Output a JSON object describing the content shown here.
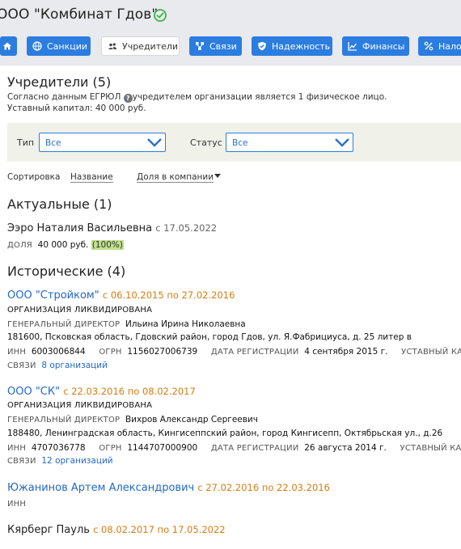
{
  "header": {
    "company_title": "ООО \"Комбинат Гдов\"",
    "status_icon": "check-circle-icon",
    "tabs": [
      {
        "label": "",
        "icon": "home-icon"
      },
      {
        "label": "Санкции",
        "icon": "globe-icon"
      },
      {
        "label": "Учредители",
        "icon": "people-icon",
        "active": true
      },
      {
        "label": "Связи",
        "icon": "network-icon"
      },
      {
        "label": "Надежность",
        "icon": "shield-check-icon"
      },
      {
        "label": "Финансы",
        "icon": "chart-icon"
      },
      {
        "label": "Налоги",
        "icon": "percent-icon"
      }
    ]
  },
  "founders": {
    "title": "Учредители (5)",
    "egrul_prefix": "Согласно данным ЕГРЮЛ",
    "egrul_suffix": "учредителем организации является 1 физическое лицо.",
    "capital": "Уставный капитал: 40 000 руб."
  },
  "filters": {
    "type_label": "Тип",
    "type_value": "Все",
    "status_label": "Статус",
    "status_value": "Все"
  },
  "sort": {
    "label": "Сортировка",
    "by_name": "Название",
    "by_share": "Доля в компании"
  },
  "current": {
    "title": "Актуальные (1)",
    "items": [
      {
        "name": "Ээро Наталия Васильевна",
        "date": "с 17.05.2022",
        "share_label": "ДОЛЯ",
        "share_value": "40 000 руб.",
        "share_pct": "(100%)"
      }
    ]
  },
  "historical": {
    "title": "Исторические (4)",
    "items": [
      {
        "name": "ООО \"Стройком\"",
        "dates": "с 06.10.2015 по 27.02.2016",
        "status": "ОРГАНИЗАЦИЯ ЛИКВИДИРОВАНА",
        "director_label": "ГЕНЕРАЛЬНЫЙ ДИРЕКТОР",
        "director": "Ильина Ирина Николаевна",
        "address": "181600, Псковская область, Гдовский район, город Гдов, ул. Я.Фабрициуса, д. 25 литер в",
        "inn_label": "ИНН",
        "inn": "6003006844",
        "ogrn_label": "ОГРН",
        "ogrn": "1156027006739",
        "reg_label": "ДАТА РЕГИСТРАЦИИ",
        "reg": "4 сентября 2015 г.",
        "capital_label": "УСТАВНЫЙ КАПИ",
        "links_label": "СВЯЗИ",
        "links": "8 организаций"
      },
      {
        "name": "ООО \"СК\"",
        "dates": "с 22.03.2016 по 08.02.2017",
        "status": "ОРГАНИЗАЦИЯ ЛИКВИДИРОВАНА",
        "director_label": "ГЕНЕРАЛЬНЫЙ ДИРЕКТОР",
        "director": "Вихров Александр Сергеевич",
        "address": "188480, Ленинградская область, Кингисеппский район, город Кингисепп, Октябрьская ул., д.26",
        "inn_label": "ИНН",
        "inn": "4707036778",
        "ogrn_label": "ОГРН",
        "ogrn": "1144707000900",
        "reg_label": "ДАТА РЕГИСТРАЦИИ",
        "reg": "26 августа 2014 г.",
        "capital_label": "УСТАВНЫЙ КАПИ",
        "links_label": "СВЯЗИ",
        "links": "12 организаций"
      },
      {
        "name": "Южанинов Артем Александрович",
        "dates": "с 27.02.2016 по 22.03.2016",
        "inn_label": "ИНН"
      },
      {
        "name": "Кярберг Пауль",
        "dates": "с 08.02.2017 по 17.05.2022"
      }
    ]
  },
  "colors": {
    "accent": "#2b7de0",
    "link": "#2369c5",
    "date": "#d47c10",
    "liquidated": "#e33b2f",
    "share_highlight": "#bde08a"
  }
}
